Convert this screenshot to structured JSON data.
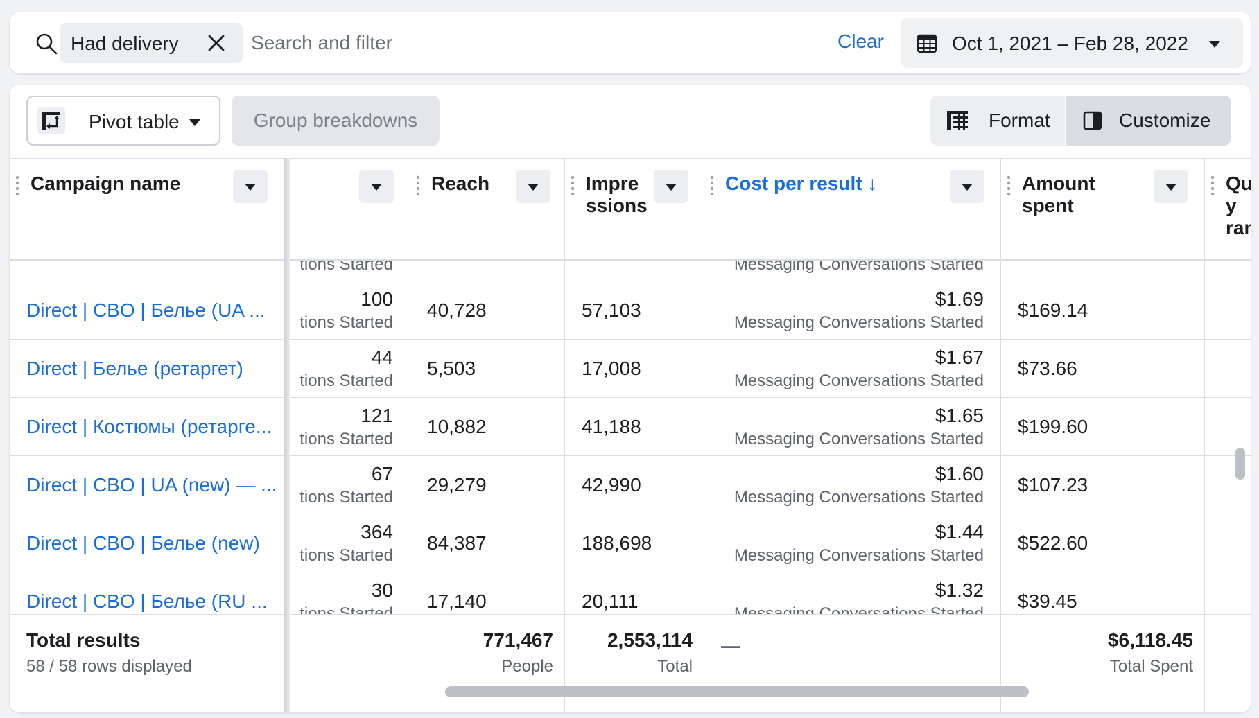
{
  "search": {
    "filter_chip": "Had delivery",
    "placeholder": "Search and filter",
    "clear_label": "Clear",
    "date_range": "Oct 1, 2021 – Feb 28, 2022"
  },
  "toolbar": {
    "pivot_label": "Pivot table",
    "group_label": "Group breakdowns",
    "format_label": "Format",
    "customize_label": "Customize"
  },
  "columns": {
    "campaign": "Campaign name",
    "reach": "Reach",
    "impressions_line1": "Impre",
    "impressions_line2": "ssions",
    "cost_per_result": "Cost per result ↓",
    "amount_line1": "Amount",
    "amount_line2": "spent",
    "quality_line1": "Qua",
    "quality_line2": "y",
    "quality_line3": "ran"
  },
  "rows": [
    {
      "campaign": "",
      "results": "",
      "results_sub": "tions Started",
      "reach": "",
      "impressions": "",
      "cost": "",
      "cost_sub": "Messaging Conversations Started",
      "amount": ""
    },
    {
      "campaign": "Direct | CBO | Белье (UA ...",
      "results": "100",
      "results_sub": "tions Started",
      "reach": "40,728",
      "impressions": "57,103",
      "cost": "$1.69",
      "cost_sub": "Messaging Conversations Started",
      "amount": "$169.14"
    },
    {
      "campaign": "Direct | Белье (ретаргет)",
      "results": "44",
      "results_sub": "tions Started",
      "reach": "5,503",
      "impressions": "17,008",
      "cost": "$1.67",
      "cost_sub": "Messaging Conversations Started",
      "amount": "$73.66"
    },
    {
      "campaign": "Direct | Костюмы (ретарге...",
      "results": "121",
      "results_sub": "tions Started",
      "reach": "10,882",
      "impressions": "41,188",
      "cost": "$1.65",
      "cost_sub": "Messaging Conversations Started",
      "amount": "$199.60"
    },
    {
      "campaign": "Direct | CBO | UA (new) — ...",
      "results": "67",
      "results_sub": "tions Started",
      "reach": "29,279",
      "impressions": "42,990",
      "cost": "$1.60",
      "cost_sub": "Messaging Conversations Started",
      "amount": "$107.23"
    },
    {
      "campaign": "Direct | CBO | Белье (new)",
      "results": "364",
      "results_sub": "tions Started",
      "reach": "84,387",
      "impressions": "188,698",
      "cost": "$1.44",
      "cost_sub": "Messaging Conversations Started",
      "amount": "$522.60"
    },
    {
      "campaign": "Direct | CBO | Белье (RU ...",
      "results": "30",
      "results_sub": "tions Started",
      "reach": "17,140",
      "impressions": "20,111",
      "cost": "$1.32",
      "cost_sub": "Messaging Conversations Started",
      "amount": "$39.45"
    }
  ],
  "footer": {
    "title": "Total results",
    "rows_displayed": "58 / 58 rows displayed",
    "reach_total": "771,467",
    "reach_sub": "People",
    "impressions_total": "2,553,114",
    "impressions_sub": "Total",
    "cost_total": "—",
    "amount_total": "$6,118.45",
    "amount_sub": "Total Spent"
  },
  "colors": {
    "accent": "#1a6ed8",
    "text": "#1c1e21",
    "muted": "#5f646b",
    "border": "#dadde1"
  },
  "icons": [
    "search-icon",
    "close-icon",
    "calendar-icon",
    "chevron-down-icon",
    "pivot-table-icon",
    "format-icon",
    "customize-icon",
    "drag-handle-icon"
  ]
}
